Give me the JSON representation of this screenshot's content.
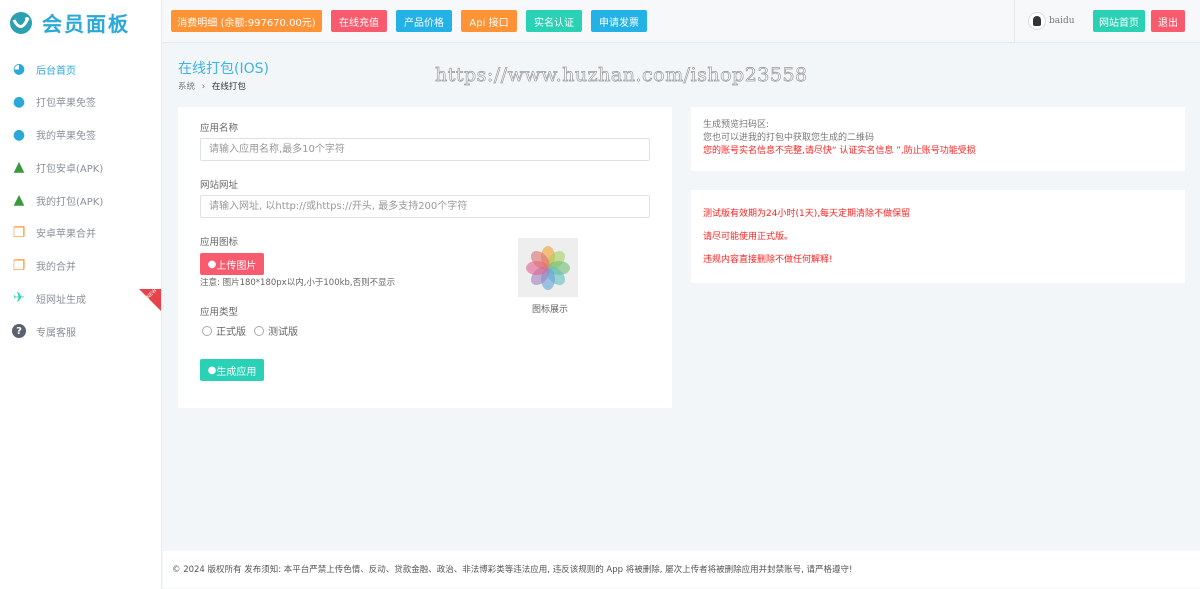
{
  "brand": {
    "name": "会员面板"
  },
  "sidebar": {
    "items": [
      {
        "label": "后台首页",
        "icon": "dashboard-icon"
      },
      {
        "label": "打包苹果免签",
        "icon": "apple-icon"
      },
      {
        "label": "我的苹果免签",
        "icon": "apple-icon"
      },
      {
        "label": "打包安卓(APK)",
        "icon": "android-icon"
      },
      {
        "label": "我的打包(APK)",
        "icon": "android-icon"
      },
      {
        "label": "安卓苹果合并",
        "icon": "copy-icon"
      },
      {
        "label": "我的合并",
        "icon": "copy-icon"
      },
      {
        "label": "短网址生成",
        "icon": "plane-icon",
        "badge": "NEW"
      },
      {
        "label": "专属客服",
        "icon": "question-icon"
      }
    ]
  },
  "header": {
    "buttons": [
      {
        "label": "消费明细 (余额:997670.00元)",
        "color": "#ff9336"
      },
      {
        "label": "在线充值",
        "color": "#f85b6d"
      },
      {
        "label": "产品价格",
        "color": "#23b1e6"
      },
      {
        "label": "Api 接口",
        "color": "#ff9336"
      },
      {
        "label": "实名认证",
        "color": "#2bd1b4"
      },
      {
        "label": "申请发票",
        "color": "#23b1e6"
      }
    ],
    "username": "baidu",
    "home_label": "网站首页",
    "logout_label": "退出"
  },
  "page": {
    "title": "在线打包(IOS)",
    "breadcrumb": [
      "系统",
      "在线打包"
    ],
    "watermark": "https://www.huzhan.com/ishop23558"
  },
  "form": {
    "name_label": "应用名称",
    "name_placeholder": "请输入应用名称,最多10个字符",
    "url_label": "网站网址",
    "url_placeholder": "请输入网址, 以http://或https://开头, 最多支持200个字符",
    "icon_label": "应用图标",
    "upload_label": "上传图片",
    "upload_note": "注意: 图片180*180px以内,小于100kb,否则不显示",
    "preview_label": "图标展示",
    "type_label": "应用类型",
    "types": [
      "正式版",
      "测试版"
    ],
    "submit_label": "生成应用"
  },
  "preview_card": {
    "lines": [
      "生成预览扫码区:",
      "您也可以进我的打包中获取您生成的二维码"
    ],
    "warning": "您的账号实名信息不完整,请尽快“ 认证实名信息 ”,防止账号功能受损"
  },
  "notice_card": {
    "lines": [
      "测试版有效期为24小时(1天),每天定期清除不做保留",
      "请尽可能使用正式版。",
      "违规内容直接删除不做任何解释!"
    ]
  },
  "footer": {
    "text": "© 2024 版权所有 发布须知: 本平台严禁上传色情、反动、贷款金融、政治、非法博彩类等违法应用, 违反该规则的 App 将被删除, 屡次上传者将被删除应用并封禁账号, 请严格遵守!"
  }
}
